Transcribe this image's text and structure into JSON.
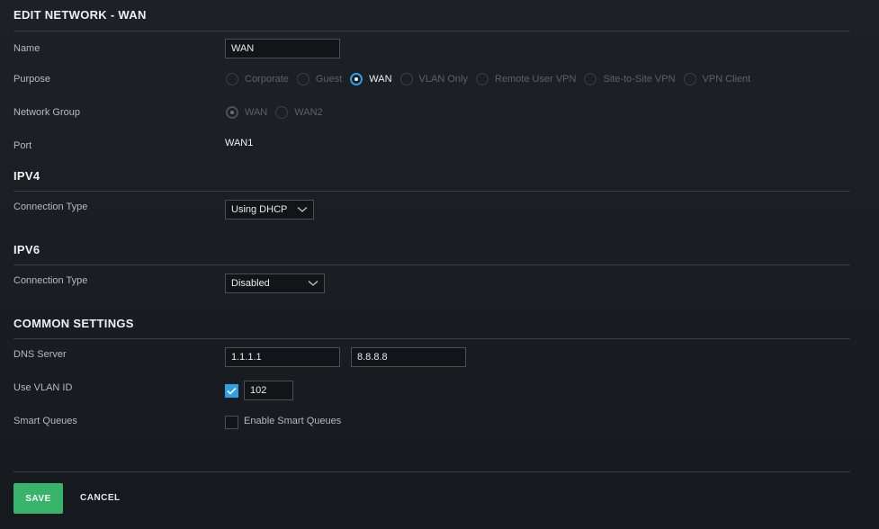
{
  "header": {
    "title": "EDIT NETWORK - WAN"
  },
  "fields": {
    "name": {
      "label": "Name",
      "value": "WAN"
    },
    "purpose": {
      "label": "Purpose",
      "options": [
        "Corporate",
        "Guest",
        "WAN",
        "VLAN Only",
        "Remote User VPN",
        "Site-to-Site VPN",
        "VPN Client"
      ],
      "selected": "WAN"
    },
    "network_group": {
      "label": "Network Group",
      "options": [
        "WAN",
        "WAN2"
      ],
      "selected": "WAN"
    },
    "port": {
      "label": "Port",
      "value": "WAN1"
    }
  },
  "ipv4": {
    "title": "IPV4",
    "connection_type_label": "Connection Type",
    "connection_type_value": "Using DHCP"
  },
  "ipv6": {
    "title": "IPV6",
    "connection_type_label": "Connection Type",
    "connection_type_value": "Disabled"
  },
  "common": {
    "title": "COMMON SETTINGS",
    "dns_label": "DNS Server",
    "dns1": "1.1.1.1",
    "dns2": "8.8.8.8",
    "vlan_label": "Use VLAN ID",
    "vlan_checked": true,
    "vlan_value": "102",
    "smart_queues_label": "Smart Queues",
    "smart_queues_checked": false,
    "smart_queues_option": "Enable Smart Queues"
  },
  "footer": {
    "save_label": "SAVE",
    "cancel_label": "CANCEL"
  },
  "colors": {
    "accent": "#2e9fe6",
    "save": "#37b36a",
    "background": "#1d2126"
  }
}
